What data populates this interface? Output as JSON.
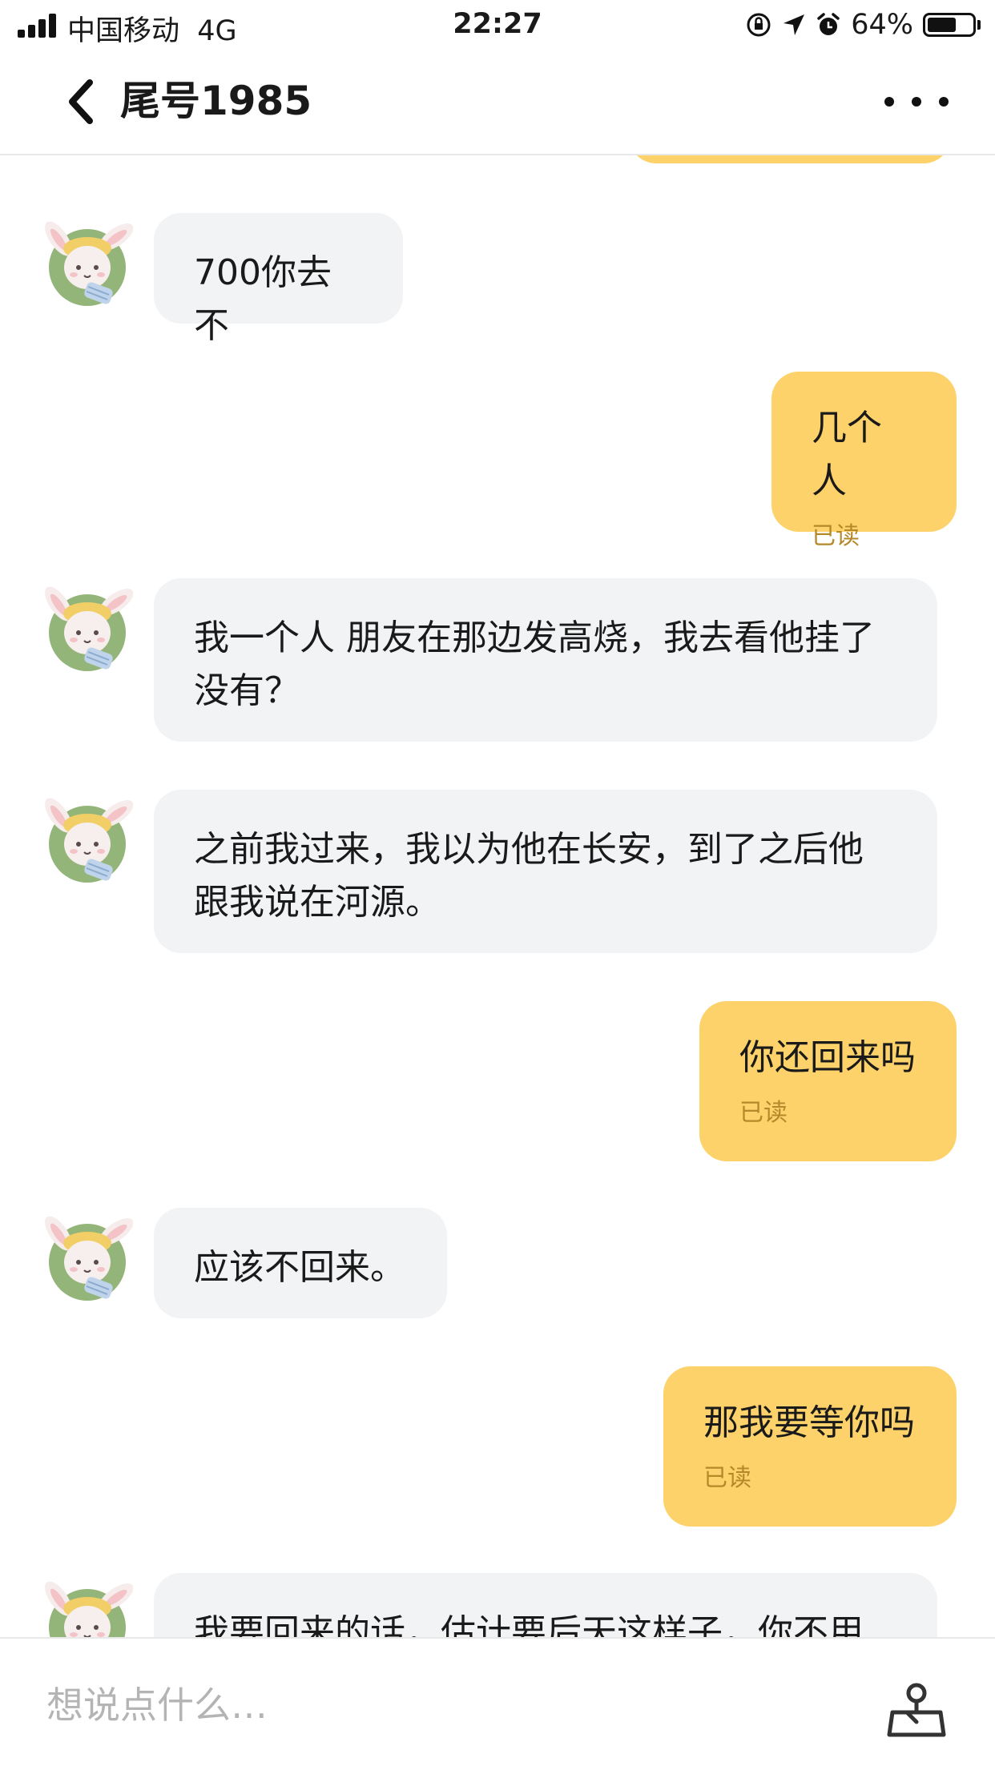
{
  "status_bar": {
    "carrier": "中国移动",
    "network": "4G",
    "time": "22:27",
    "battery": "64%",
    "battery_level": 0.64,
    "icons": [
      "signal-icon",
      "rotation-lock-icon",
      "location-icon",
      "alarm-icon",
      "battery-icon"
    ]
  },
  "header": {
    "title": "尾号1985",
    "back_icon": "chevron-left-icon",
    "more_icon": "more-dots-icon"
  },
  "messages": [
    {
      "from": "them",
      "text": "700你去不"
    },
    {
      "from": "me",
      "text": "几个人",
      "status": "已读"
    },
    {
      "from": "them",
      "text": "我一个人 朋友在那边发高烧，我去看他挂了没有？"
    },
    {
      "from": "them",
      "text": "之前我过来，我以为他在长安，到了之后他跟我说在河源。"
    },
    {
      "from": "me",
      "text": "你还回来吗",
      "status": "已读"
    },
    {
      "from": "them",
      "text": "应该不回来。"
    },
    {
      "from": "me",
      "text": "那我要等你吗",
      "status": "已读"
    },
    {
      "from": "them",
      "text": "我要回来的话，估计要后天这样子，你不用"
    }
  ],
  "input": {
    "placeholder": "想说点什么…",
    "action_icon": "share-location-icon"
  },
  "colors": {
    "outgoing_bubble": "#fdd26a",
    "incoming_bubble": "#f2f3f5",
    "read_receipt": "#b5892a",
    "placeholder": "#b4b4b4"
  }
}
